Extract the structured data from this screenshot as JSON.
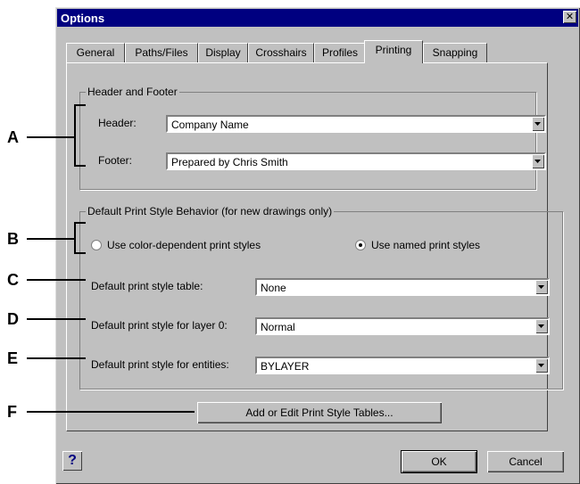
{
  "window": {
    "title": "Options",
    "close_glyph": "✕"
  },
  "tabs": [
    {
      "label": "General"
    },
    {
      "label": "Paths/Files"
    },
    {
      "label": "Display"
    },
    {
      "label": "Crosshairs"
    },
    {
      "label": "Profiles"
    },
    {
      "label": "Printing",
      "active": true
    },
    {
      "label": "Snapping"
    }
  ],
  "header_footer": {
    "group_label": "Header and Footer",
    "header_label": "Header:",
    "header_value": "Company Name",
    "footer_label": "Footer:",
    "footer_value": "Prepared by Chris Smith"
  },
  "print_style": {
    "group_label": "Default Print Style Behavior (for new drawings only)",
    "radio_color_label": "Use color-dependent print styles",
    "radio_color_selected": false,
    "radio_named_label": "Use named print styles",
    "radio_named_selected": true,
    "table_label": "Default print style table:",
    "table_value": "None",
    "layer0_label": "Default print style for layer 0:",
    "layer0_value": "Normal",
    "entities_label": "Default print style for entities:",
    "entities_value": "BYLAYER",
    "add_edit_button": "Add or Edit Print Style Tables..."
  },
  "footer_buttons": {
    "help": "?",
    "ok": "OK",
    "cancel": "Cancel"
  },
  "callouts": [
    "A",
    "B",
    "C",
    "D",
    "E",
    "F"
  ]
}
